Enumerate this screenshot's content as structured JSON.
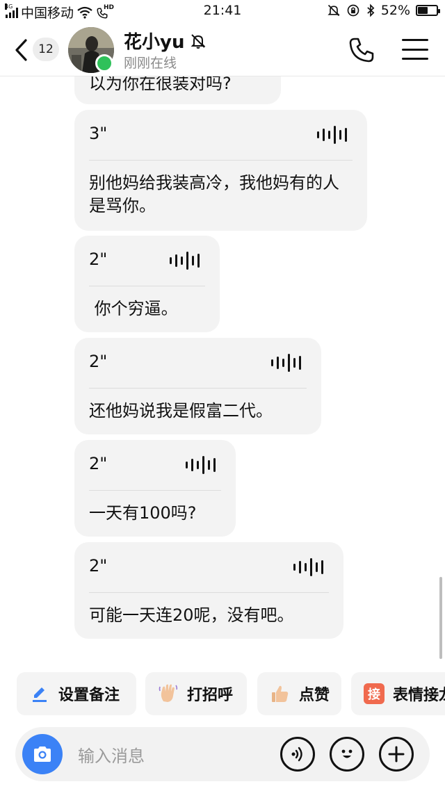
{
  "status_bar": {
    "network_label": "4G",
    "carrier": "中国移动",
    "hd_label": "HD",
    "time": "21:41",
    "battery_text": "52%",
    "battery_level": 0.52
  },
  "header": {
    "unread_count": "12",
    "contact_name": "花小yu",
    "contact_status": "刚刚在线"
  },
  "messages": [
    {
      "text": "以为你在很装对吗?"
    },
    {
      "duration": "3\"",
      "text": "别他妈给我装高冷，我他妈有的人是骂你。"
    },
    {
      "duration": "2\"",
      "text": " 你个穷逼。"
    },
    {
      "duration": "2\"",
      "text": "还他妈说我是假富二代。"
    },
    {
      "duration": "2\"",
      "text": "一天有100吗?"
    },
    {
      "duration": "2\"",
      "text": "可能一天连20呢，没有吧。"
    }
  ],
  "quick_actions": [
    {
      "label": "设置备注",
      "icon": "edit-icon"
    },
    {
      "label": "打招呼",
      "icon": "wave-hand-icon"
    },
    {
      "label": "点赞",
      "icon": "thumbs-up-icon"
    },
    {
      "label": "表情接龙",
      "icon_text": "接",
      "icon": "emoji-chain-icon"
    }
  ],
  "input": {
    "placeholder": "输入消息"
  },
  "colors": {
    "accent": "#3b82f6",
    "online": "#2fc15a",
    "bubble": "#f3f3f3"
  }
}
